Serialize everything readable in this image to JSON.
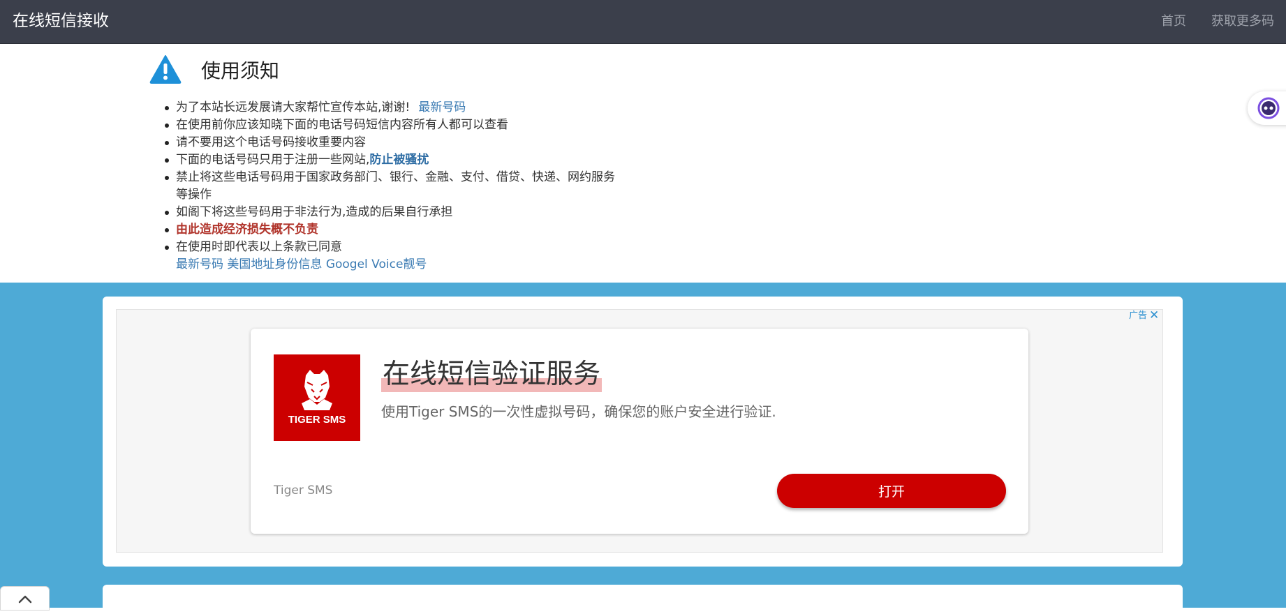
{
  "navbar": {
    "brand": "在线短信接收",
    "links": [
      "首页",
      "获取更多码"
    ]
  },
  "notice": {
    "title": "使用须知",
    "items": {
      "item1_text": "为了本站长远发展请大家帮忙宣传本站,谢谢!",
      "item1_link": "最新号码",
      "item2": "在使用前你应该知晓下面的电话号码短信内容所有人都可以查看",
      "item3": "请不要用这个电话号码接收重要内容",
      "item4_text": "下面的电话号码只用于注册一些网站,",
      "item4_link": "防止被骚扰",
      "item5_line1": "禁止将这些电话号码用于国家政务部门、银行、金融、支付、借贷、快递、网约服务",
      "item5_line2": "等操作",
      "item6": "如阁下将这些号码用于非法行为,造成的后果自行承担",
      "item7": "由此造成经济损失概不负责",
      "item8": "在使用时即代表以上条款已同意"
    },
    "footer_links": [
      "最新号码",
      "美国地址身份信息",
      "Googel Voice靓号"
    ]
  },
  "ad": {
    "label": "广告",
    "close": "✕",
    "logo_text": "TIGER SMS",
    "headline": "在线短信验证服务",
    "description": "使用Tiger SMS的一次性虚拟号码，确保您的账户安全进行验证.",
    "advertiser": "Tiger SMS",
    "cta": "打开"
  },
  "colors": {
    "navbar_bg": "#3b3f4b",
    "band_bg": "#4eaad6",
    "link": "#3b7bb3",
    "warning_red": "#b0332a",
    "ad_red": "#cc0000"
  }
}
